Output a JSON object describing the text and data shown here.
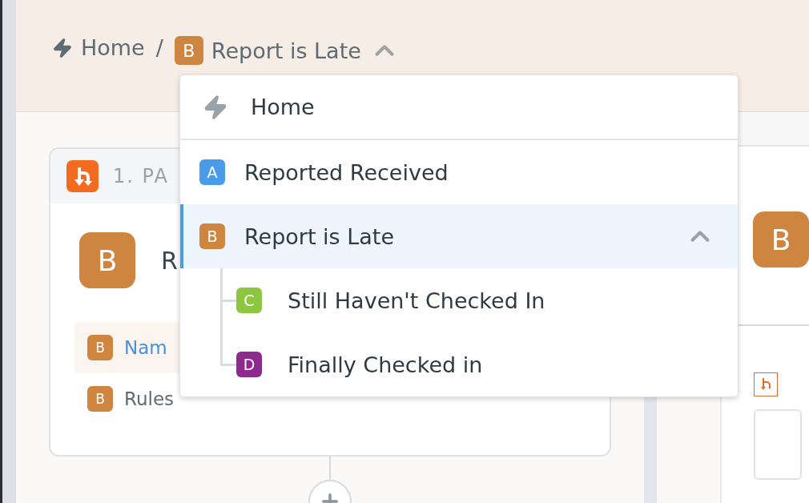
{
  "breadcrumb": {
    "items": [
      {
        "kind": "home",
        "label": "Home"
      },
      {
        "kind": "path",
        "badge": "B",
        "color": "#cd853f",
        "label": "Report is Late",
        "expanded": true
      }
    ],
    "separator": "/"
  },
  "path_menu": {
    "home": {
      "label": "Home"
    },
    "paths": [
      {
        "badge": "A",
        "color": "#4a9be8",
        "label": "Reported Received",
        "selected": false
      },
      {
        "badge": "B",
        "color": "#cd853f",
        "label": "Report is Late",
        "selected": true,
        "expanded": true,
        "children": [
          {
            "badge": "C",
            "color": "#8dc63f",
            "label": "Still Haven't Checked In",
            "selected": false
          },
          {
            "badge": "D",
            "color": "#8e2a8e",
            "label": "Finally Checked in",
            "selected": false
          }
        ]
      }
    ]
  },
  "step_card": {
    "title": "1. PA",
    "badge": "B",
    "color": "#cd853f",
    "heading": "R",
    "rows": [
      {
        "badge": "B",
        "label": "Nam",
        "selected": true
      },
      {
        "badge": "B",
        "label": "Rules",
        "selected": false
      }
    ]
  },
  "side_panel": {
    "badge": "B",
    "color": "#cd853f"
  }
}
